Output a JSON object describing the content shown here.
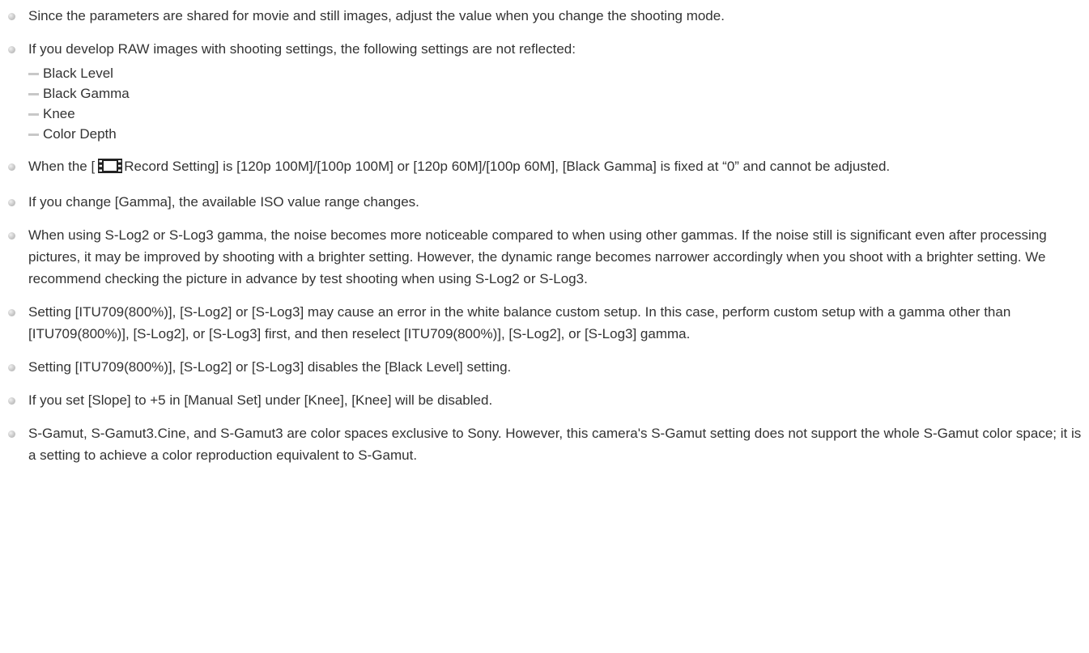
{
  "notes": [
    {
      "text": "Since the parameters are shared for movie and still images, adjust the value when you change the shooting mode."
    },
    {
      "text": "If you develop RAW images with shooting settings, the following settings are not reflected:",
      "subitems": [
        "Black Level",
        "Black Gamma",
        "Knee",
        "Color Depth"
      ]
    },
    {
      "text_before_icon": "When the [",
      "icon": "movie-film-icon",
      "text_after_icon": "Record Setting] is [120p 100M]/[100p 100M] or [120p 60M]/[100p 60M], [Black Gamma] is fixed at “0” and cannot be adjusted."
    },
    {
      "text": "If you change [Gamma], the available ISO value range changes."
    },
    {
      "text": "When using S-Log2 or S-Log3 gamma, the noise becomes more noticeable compared to when using other gammas. If the noise still is significant even after processing pictures, it may be improved by shooting with a brighter setting. However, the dynamic range becomes narrower accordingly when you shoot with a brighter setting. We recommend checking the picture in advance by test shooting when using S-Log2 or S-Log3."
    },
    {
      "text": "Setting [ITU709(800%)], [S-Log2] or [S-Log3] may cause an error in the white balance custom setup. In this case, perform custom setup with a gamma other than [ITU709(800%)], [S-Log2], or [S-Log3] first, and then reselect [ITU709(800%)], [S-Log2], or [S-Log3] gamma."
    },
    {
      "text": "Setting [ITU709(800%)], [S-Log2] or [S-Log3] disables the [Black Level] setting."
    },
    {
      "text": "If you set [Slope] to +5 in [Manual Set] under [Knee], [Knee] will be disabled."
    },
    {
      "text": "S-Gamut, S-Gamut3.Cine, and S-Gamut3 are color spaces exclusive to Sony. However, this camera's S-Gamut setting does not support the whole S-Gamut color space; it is a setting to achieve a color reproduction equivalent to S-Gamut."
    }
  ],
  "colors": {
    "text": "#333333",
    "bullet": "#bdbdbd",
    "dash": "#c8c8c8"
  }
}
